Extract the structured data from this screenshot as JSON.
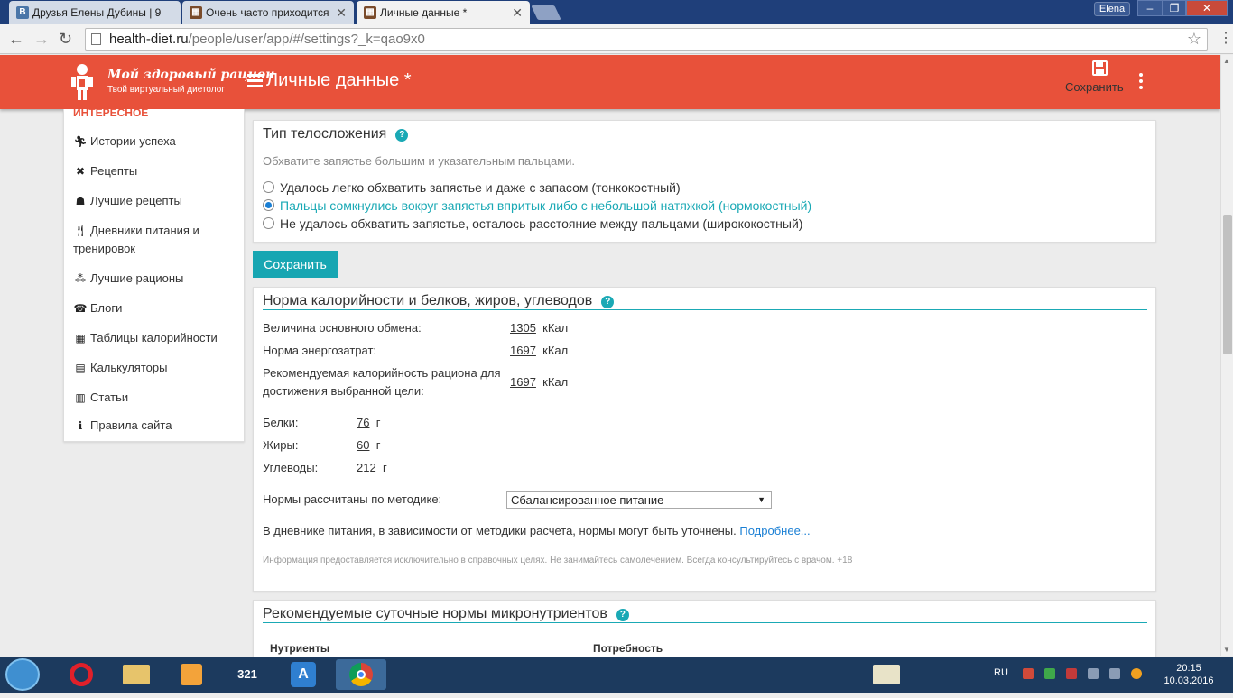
{
  "browser": {
    "tabs": [
      {
        "title": "Друзья Елены Дубины | 9",
        "icon": "vk-icon"
      },
      {
        "title": "Очень часто приходится",
        "icon": "cube-icon"
      },
      {
        "title": "Личные данные *",
        "icon": "cube-icon"
      }
    ],
    "user_name": "Elena",
    "url_host": "health-diet.ru",
    "url_path": "/people/user/app/#/settings?_k=qao9x0"
  },
  "site": {
    "logo_title": "Мой здоровый рацион",
    "logo_subtitle": "Твой виртуальный диетолог",
    "page_title": "Личные данные *",
    "save_label": "Сохранить"
  },
  "sidebar": {
    "heading": "ИНТЕРЕСНОЕ",
    "items": [
      {
        "label": "Истории успеха",
        "icon": "runner-icon"
      },
      {
        "label": "Рецепты",
        "icon": "recipe-icon"
      },
      {
        "label": "Лучшие рецепты",
        "icon": "medal-icon"
      },
      {
        "label": "Дневники питания и тренировок",
        "icon": "fork-knife-icon"
      },
      {
        "label": "Лучшие рационы",
        "icon": "rations-icon"
      },
      {
        "label": "Блоги",
        "icon": "blog-icon"
      },
      {
        "label": "Таблицы калорийности",
        "icon": "table-icon"
      },
      {
        "label": "Калькуляторы",
        "icon": "calculator-icon"
      },
      {
        "label": "Статьи",
        "icon": "article-icon"
      },
      {
        "label": "Правила сайта",
        "icon": "info-icon"
      }
    ]
  },
  "body_type": {
    "title": "Тип телосложения",
    "hint": "Обхватите запястье большим и указательным пальцами.",
    "options": [
      "Удалось легко обхватить запястье и даже с запасом (тонкокостный)",
      "Пальцы сомкнулись вокруг запястья впритык либо с небольшой натяжкой (нормокостный)",
      "Не удалось обхватить запястье, осталось расстояние между пальцами (ширококостный)"
    ],
    "selected_index": 1
  },
  "save_button": "Сохранить",
  "calories": {
    "title": "Норма калорийности и белков, жиров, углеводов",
    "bmr_label": "Величина основного обмена:",
    "bmr_value": "1305",
    "energy_label": "Норма энергозатрат:",
    "energy_value": "1697",
    "recommended_label_1": "Рекомендуемая калорийность рациона для",
    "recommended_label_2": "достижения выбранной цели:",
    "recommended_value": "1697",
    "kcal_unit": "кКал",
    "protein_label": "Белки:",
    "protein_value": "76",
    "fat_label": "Жиры:",
    "fat_value": "60",
    "carbs_label": "Углеводы:",
    "carbs_value": "212",
    "gram_unit": "г",
    "method_label": "Нормы рассчитаны по методике:",
    "method_value": "Сбалансированное питание",
    "diary_note": "В дневнике питания, в зависимости от методики расчета, нормы могут быть уточнены.",
    "more_link": "Подробнее...",
    "disclaimer": "Информация предоставляется исключительно в справочных целях. Не занимайтесь самолечением. Всегда консультируйтесь с врачом. +18"
  },
  "micronutrients": {
    "title": "Рекомендуемые суточные нормы микронутриентов",
    "col_nutrients": "Нутриенты",
    "col_need": "Потребность"
  },
  "taskbar": {
    "lang": "RU",
    "time": "20:15",
    "date": "10.03.2016"
  }
}
